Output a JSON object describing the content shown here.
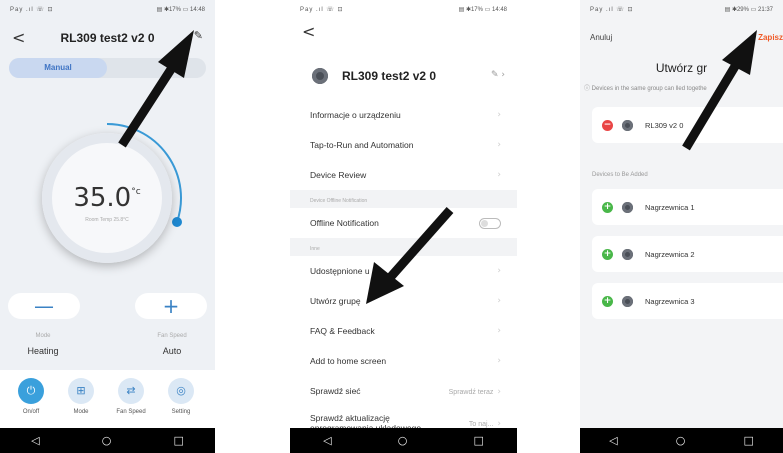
{
  "phone1": {
    "status": {
      "left": "Pay .ıl ☏ ⊡",
      "right": "▤ ✱17% ▭ 14:48"
    },
    "title": "RL309 test2 v2 0",
    "mode_tab": "Manual",
    "temperature": "35.0",
    "unit": "°c",
    "room_temp": "Room Temp 25.8°C",
    "minus": "—",
    "plus": "+",
    "mode_label": "Mode",
    "mode_value": "Heating",
    "fan_label": "Fan Speed",
    "fan_value": "Auto",
    "bottom": [
      {
        "label": "On/off",
        "icon": "power-icon",
        "glyph": "⏻"
      },
      {
        "label": "Mode",
        "icon": "grid-icon",
        "glyph": "⊞"
      },
      {
        "label": "Fan Speed",
        "icon": "sliders-icon",
        "glyph": "⇄"
      },
      {
        "label": "Setting",
        "icon": "settings-icon",
        "glyph": "◎"
      }
    ]
  },
  "phone2": {
    "status": {
      "left": "Pay .ıl ☏ ⊡",
      "right": "▤ ✱17% ▭ 14:48"
    },
    "device_name": "RL309 test2 v2 0",
    "rows_a": [
      "Informacje o urządzeniu",
      "Tap-to-Run and Automation",
      "Device Review"
    ],
    "section_offline": "Device Offline Notification",
    "offline_notification": "Offline Notification",
    "section_inne": "Inne",
    "rows_b": [
      "Udostępnione u",
      "Utwórz grupę",
      "FAQ & Feedback",
      "Add to home screen"
    ],
    "check_network": "Sprawdź sieć",
    "check_network_hint": "Sprawdź teraz",
    "firmware_line1": "Sprawdź aktualizację",
    "firmware_line2": "oprogramowania układowego",
    "firmware_hint": "To naj..."
  },
  "phone3": {
    "status": {
      "left": "Pay .ıl ☏ ⊡",
      "right": "▤ ✱29% ▭ 21:37"
    },
    "cancel": "Anuluj",
    "save": "Zapisz",
    "title": "Utwórz gr",
    "info": "Devices in the same group can      lled togethe",
    "group_device": "RL309    v2 0",
    "section": "Devices to Be Added",
    "devices": [
      "Nagrzewnica 1",
      "Nagrzewnica 2",
      "Nagrzewnica 3"
    ]
  },
  "nav": {
    "back": "◁",
    "home": "○",
    "recent": "□"
  },
  "colors": {
    "accent_blue": "#3a82c4",
    "save_orange": "#f05a28",
    "remove_red": "#e94545",
    "add_green": "#49b749",
    "arrow": "#111111"
  }
}
